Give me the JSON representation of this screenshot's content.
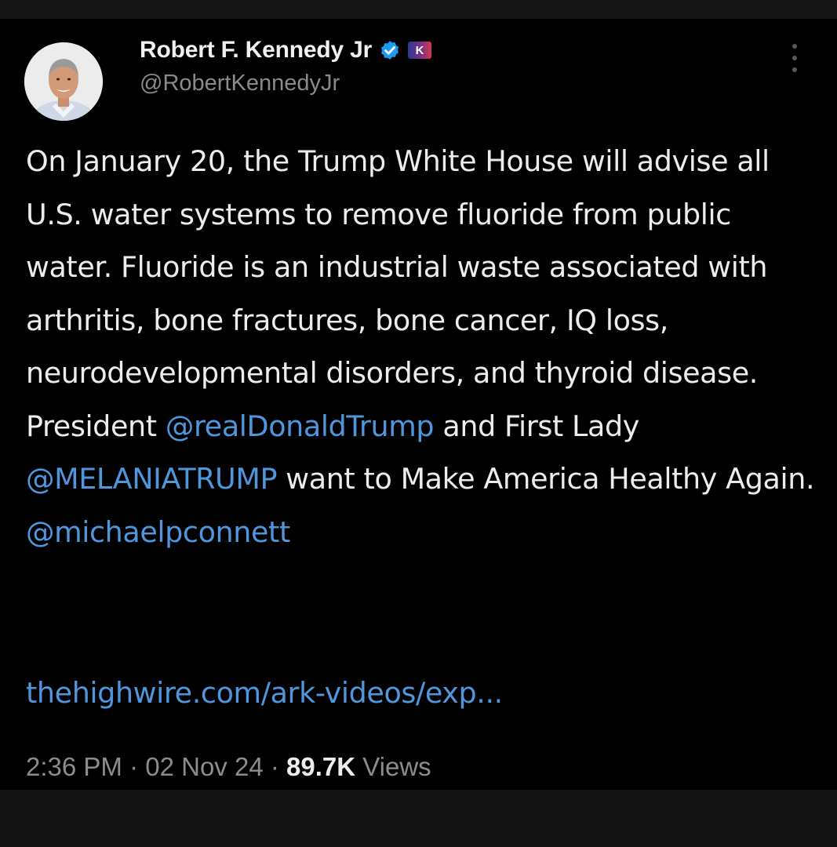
{
  "tweet": {
    "author": {
      "display_name": "Robert F. Kennedy Jr",
      "handle": "@RobertKennedyJr",
      "badge_text": "K"
    },
    "body": [
      {
        "text": "On January 20, the Trump White House will advise all U.S. water systems to remove fluoride from public water. Fluoride is an industrial waste associated with arthritis, bone fractures, bone cancer, IQ loss, neurodevelopmental disorders, and thyroid disease. President "
      },
      {
        "mention": "@realDonaldTrump"
      },
      {
        "text": " and First Lady "
      },
      {
        "mention": "@MELANIATRUMP"
      },
      {
        "text": " want to Make America Healthy Again. "
      },
      {
        "mention": "@michaelpconnett"
      }
    ],
    "link": "thehighwire.com/ark-videos/exp...",
    "time": "2:36 PM",
    "separator": " · ",
    "date": "02 Nov 24",
    "views_count": "89.7K",
    "views_label": " Views"
  },
  "colors": {
    "background": "#000000",
    "text": "#ececec",
    "mention": "#4f96dc",
    "muted": "#8c8c8c",
    "verified": "#1d9bf0"
  },
  "icons": {
    "verified": "verified-badge-icon",
    "more": "more-vertical-icon"
  }
}
